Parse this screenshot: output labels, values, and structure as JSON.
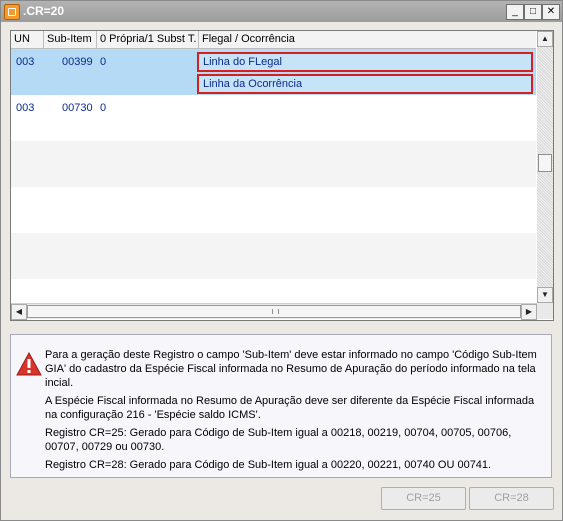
{
  "window": {
    "title": ".CR=20",
    "minimize": "_",
    "maximize": "□",
    "close": "✕",
    "icon": "app-window-icon"
  },
  "grid": {
    "columns": [
      "UN",
      "Sub-Item",
      "0 Própria/1 Subst T.",
      "Flegal / Ocorrência"
    ],
    "rows": [
      {
        "un": "003",
        "sub_item": "00399",
        "propria": "0",
        "flegal": "Linha do FLegal",
        "ocorrencia": "Linha da Ocorrência"
      },
      {
        "un": "003",
        "sub_item": "00730",
        "propria": "0",
        "flegal": "",
        "ocorrencia": ""
      }
    ]
  },
  "info": {
    "icon": "warning-icon",
    "paragraphs": [
      "Para a geração deste Registro o campo 'Sub-Item' deve estar informado no campo 'Código Sub-Item GIA' do cadastro da Espécie Fiscal informada no Resumo de Apuração do período informado na tela incial.",
      "A Espécie Fiscal informada no Resumo de Apuração deve ser diferente da Espécie Fiscal informada na configuração 216 - 'Espécie saldo ICMS'.",
      "Registro CR=25: Gerado para Código de Sub-Item igual a 00218, 00219, 00704, 00705, 00706, 00707, 00729 ou 00730.",
      "Registro CR=28: Gerado para Código de Sub-Item igual a 00220, 00221, 00740 OU 00741."
    ]
  },
  "buttons": {
    "cr25": "CR=25",
    "cr28": "CR=28"
  }
}
